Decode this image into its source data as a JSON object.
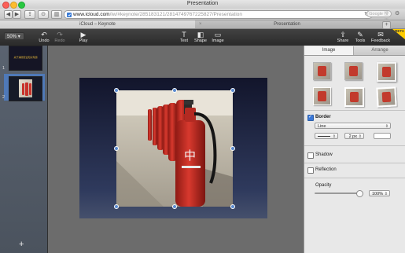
{
  "window": {
    "title": "Presentation"
  },
  "browser": {
    "url_host": "www.icloud.com",
    "url_path": "/iw/#keynote/285183121/2814749767225827/Presentation",
    "search_placeholder": "Google 搜索",
    "tabs": [
      {
        "label": "iCloud – Keynote",
        "active": true
      },
      {
        "label": "Presentation",
        "active": false
      }
    ],
    "new_tab_label": "+"
  },
  "toolbar": {
    "zoom": "50%",
    "undo": "Undo",
    "redo": "Redo",
    "play": "Play",
    "text": "Text",
    "shape": "Shape",
    "image": "Image",
    "share": "Share",
    "tools": "Tools",
    "feedback": "Feedback",
    "badge": "BETA"
  },
  "navigator": {
    "slides": [
      {
        "number": "1",
        "title": "关于消防安全知识专题"
      },
      {
        "number": "2"
      }
    ],
    "add_label": "+"
  },
  "inspector": {
    "tabs": {
      "image": "Image",
      "arrange": "Arrange"
    },
    "border": {
      "label": "Border",
      "checked": true,
      "style": "Line",
      "width": "2 px"
    },
    "shadow": {
      "label": "Shadow",
      "checked": false
    },
    "reflection": {
      "label": "Reflection",
      "checked": false
    },
    "opacity": {
      "label": "Opacity",
      "value": "100%",
      "level": 1.0
    }
  },
  "colors": {
    "accent": "#3b78d8",
    "selection": "#4f79b8",
    "extinguisher": "#c8322a"
  }
}
